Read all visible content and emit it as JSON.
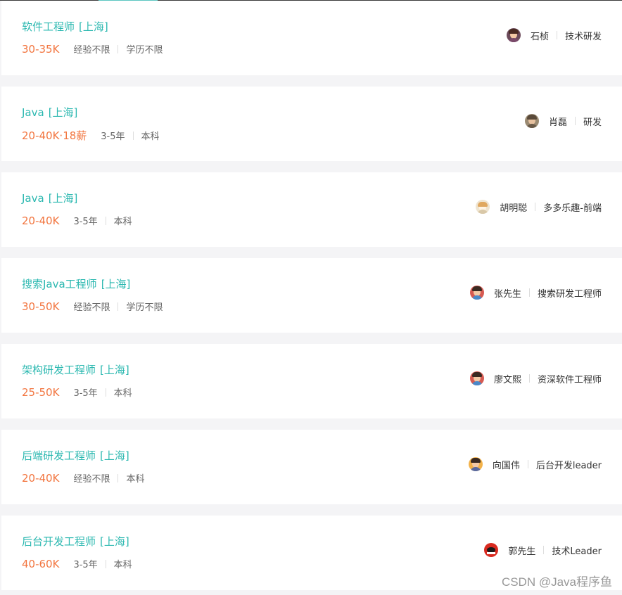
{
  "jobs": [
    {
      "title": "软件工程师",
      "city": "[上海]",
      "salary": "30-35K",
      "experience": "经验不限",
      "education": "学历不限",
      "recruiter": "石桢",
      "team": "技术研发",
      "avatar_icon": "person-avatar-icon",
      "avatar_color": "#7a4a6a"
    },
    {
      "title": "Java",
      "city": "[上海]",
      "salary": "20-40K·18薪",
      "experience": "3-5年",
      "education": "本科",
      "recruiter": "肖磊",
      "team": "研发",
      "avatar_icon": "person-avatar-icon",
      "avatar_color": "#8a7a66"
    },
    {
      "title": "Java",
      "city": "[上海]",
      "salary": "20-40K",
      "experience": "3-5年",
      "education": "本科",
      "recruiter": "胡明聪",
      "team": "多多乐趣-前端",
      "avatar_icon": "cartoon-avatar-icon",
      "avatar_color": "#e8d9c0"
    },
    {
      "title": "搜索Java工程师",
      "city": "[上海]",
      "salary": "30-50K",
      "experience": "经验不限",
      "education": "学历不限",
      "recruiter": "张先生",
      "team": "搜索研发工程师",
      "avatar_icon": "person-avatar-icon",
      "avatar_color": "#d0544c"
    },
    {
      "title": "架构研发工程师",
      "city": "[上海]",
      "salary": "25-50K",
      "experience": "3-5年",
      "education": "本科",
      "recruiter": "廖文熙",
      "team": "资深软件工程师",
      "avatar_icon": "person-avatar-icon",
      "avatar_color": "#d0544c"
    },
    {
      "title": "后端研发工程师",
      "city": "[上海]",
      "salary": "20-40K",
      "experience": "经验不限",
      "education": "本科",
      "recruiter": "向国伟",
      "team": "后台开发leader",
      "avatar_icon": "person-avatar-icon",
      "avatar_color": "#f0a830"
    },
    {
      "title": "后台开发工程师",
      "city": "[上海]",
      "salary": "40-60K",
      "experience": "3-5年",
      "education": "本科",
      "recruiter": "郭先生",
      "team": "技术Leader",
      "avatar_icon": "logo-avatar-icon",
      "avatar_color": "#d82a20"
    }
  ],
  "watermark": "CSDN @Java程序鱼",
  "colors": {
    "title": "#2bb8b0",
    "salary": "#f2753f",
    "background": "#f4f4f6",
    "card": "#ffffff"
  }
}
